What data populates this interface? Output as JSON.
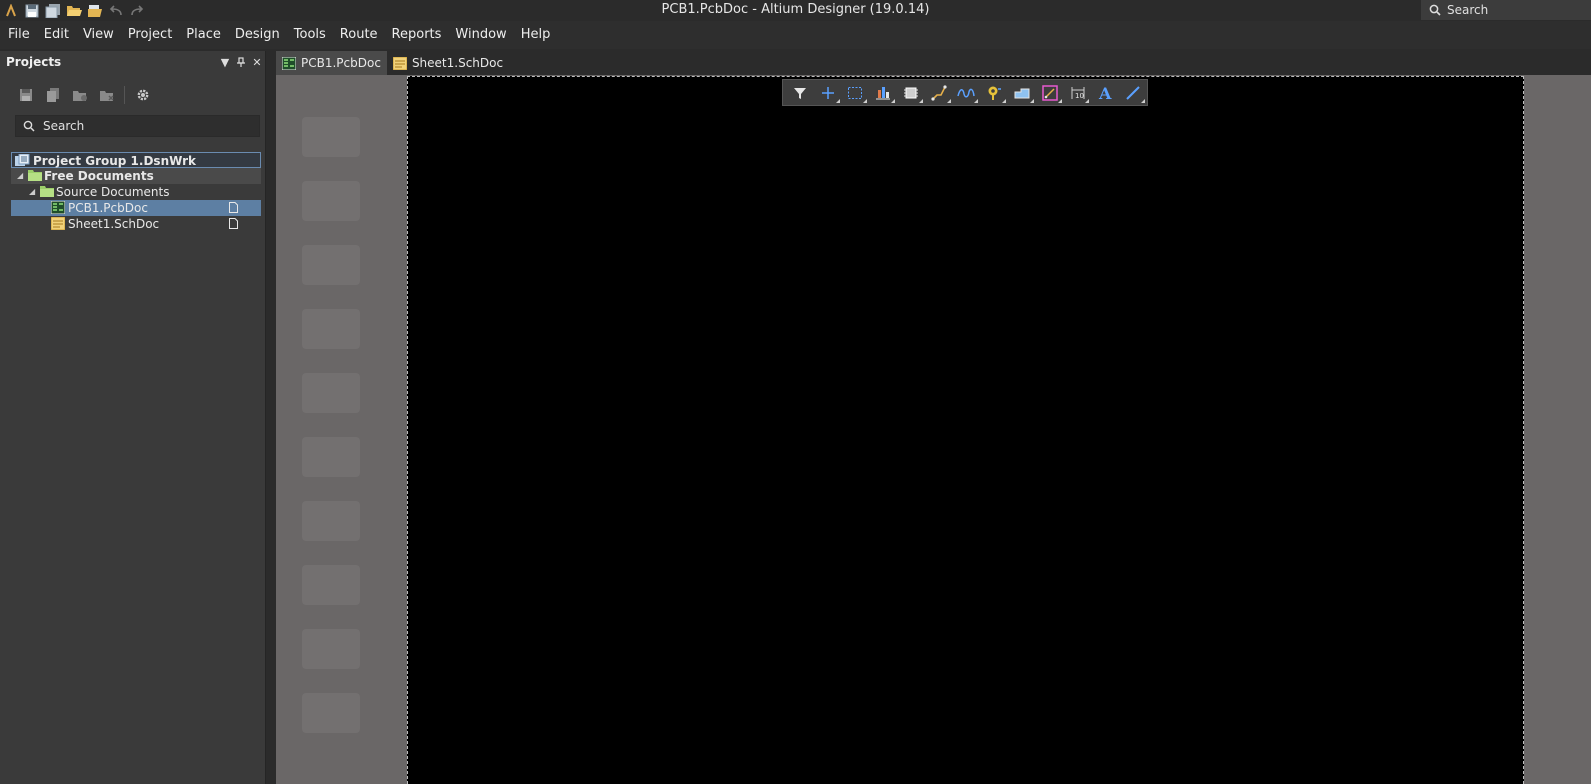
{
  "window": {
    "title": "PCB1.PcbDoc - Altium Designer (19.0.14)"
  },
  "quick_access": [
    "app-logo-icon",
    "save-icon",
    "save-all-icon",
    "open-icon",
    "open-project-icon",
    "undo-icon",
    "redo-icon"
  ],
  "title_search": {
    "placeholder": "Search"
  },
  "menu": [
    "File",
    "Edit",
    "View",
    "Project",
    "Place",
    "Design",
    "Tools",
    "Route",
    "Reports",
    "Window",
    "Help"
  ],
  "panel": {
    "title": "Projects",
    "search_placeholder": "Search",
    "tree": [
      {
        "label": "Project Group 1.DsnWrk",
        "icon": "project-group-icon"
      },
      {
        "label": "Free Documents",
        "icon": "folder-icon"
      },
      {
        "label": "Source Documents",
        "icon": "folder-icon"
      },
      {
        "label": "PCB1.PcbDoc",
        "icon": "pcb-doc-icon"
      },
      {
        "label": "Sheet1.SchDoc",
        "icon": "sch-doc-icon"
      }
    ]
  },
  "tabs": [
    {
      "label": "PCB1.PcbDoc",
      "active": true
    },
    {
      "label": "Sheet1.SchDoc",
      "active": false
    }
  ],
  "active_toolbar": [
    "filter-icon",
    "crosshair-icon",
    "select-region-icon",
    "align-icon",
    "component-icon",
    "route-icon",
    "diff-pair-icon",
    "via-icon",
    "polygon-icon",
    "keepout-icon",
    "dimension-icon",
    "text-icon",
    "line-icon"
  ],
  "colors": {
    "accent": "#5d7fa3",
    "sheet": "#000000",
    "canvas": "#6a6767",
    "chrome": "#2b2b2b"
  }
}
